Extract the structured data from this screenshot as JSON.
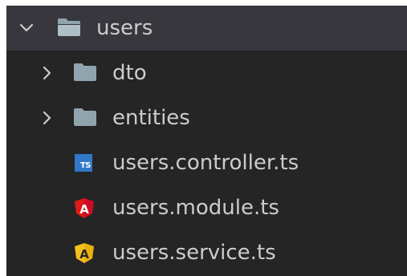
{
  "explorer": {
    "folder": {
      "name": "users",
      "expanded": true,
      "chevron_icon": "chevron-down-icon",
      "folder_icon": "folder-open-icon"
    },
    "items": [
      {
        "label": "dto",
        "type": "folder",
        "chevron_icon": "chevron-right-icon",
        "icon": "folder-icon"
      },
      {
        "label": "entities",
        "type": "folder",
        "chevron_icon": "chevron-right-icon",
        "icon": "folder-icon"
      },
      {
        "label": "users.controller.ts",
        "type": "file",
        "icon": "typescript-icon",
        "icon_text": "TS"
      },
      {
        "label": "users.module.ts",
        "type": "file",
        "icon": "angular-module-icon",
        "icon_text": "A"
      },
      {
        "label": "users.service.ts",
        "type": "file",
        "icon": "angular-service-icon",
        "icon_text": "A"
      }
    ]
  },
  "colors": {
    "background": "#252526",
    "selected_row": "#37373d",
    "text": "#cccccc",
    "folder": "#90a4ae",
    "typescript": "#3178c6",
    "angular_module": "#dd1b16",
    "angular_service": "#f2c01c"
  }
}
